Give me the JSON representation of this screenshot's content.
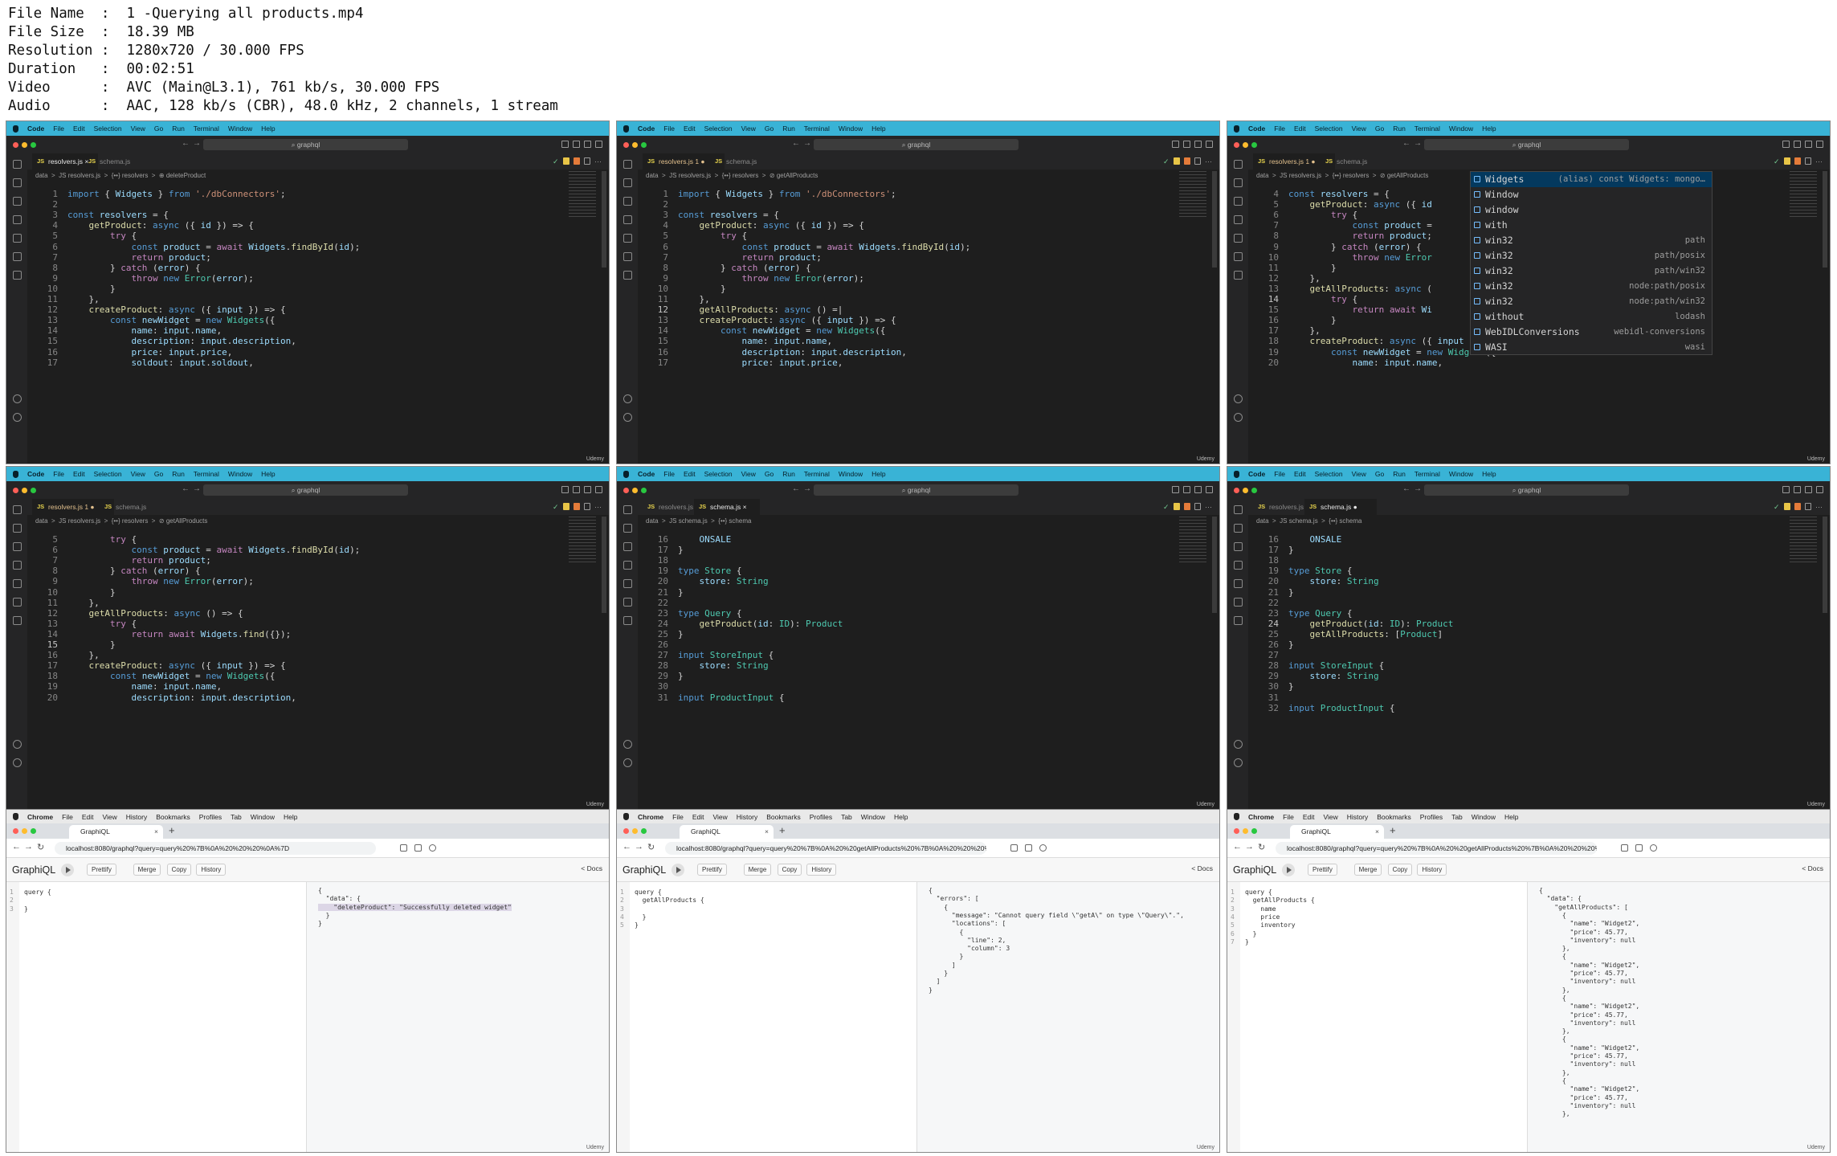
{
  "file_info": [
    "File Name  :  1 -Querying all products.mp4",
    "File Size  :  18.39 MB",
    "Resolution :  1280x720 / 30.000 FPS",
    "Duration   :  00:02:51",
    "Video      :  AVC (Main@L3.1), 761 kb/s, 30.000 FPS",
    "Audio      :  AAC, 128 kb/s (CBR), 48.0 kHz, 2 channels, 1 stream"
  ],
  "vscode_menu": [
    "Code",
    "File",
    "Edit",
    "Selection",
    "View",
    "Go",
    "Run",
    "Terminal",
    "Window",
    "Help"
  ],
  "chrome_menu": [
    "Chrome",
    "File",
    "Edit",
    "View",
    "History",
    "Bookmarks",
    "Profiles",
    "Tab",
    "Window",
    "Help"
  ],
  "command_center": "graphql",
  "watermark": "Udemy",
  "panels": [
    {
      "tabs": [
        {
          "name": "resolvers.js",
          "x": 6,
          "w": 62,
          "active": true,
          "close": "×"
        },
        {
          "name": "schema.js",
          "x": 70,
          "w": 60
        }
      ],
      "crumb": "data  >  JS resolvers.js  >  {••} resolvers  >  ⊕ deleteProduct",
      "start": 1,
      "cur": 0,
      "lines": [
        "<span class=k>import</span> { <span class=v>Widgets</span> } <span class=k>from</span> <span class=s>'./dbConnectors'</span>;",
        "",
        "<span class=k>const</span> <span class=v>resolvers</span> = {",
        "    <span class=f>getProduct</span>: <span class=k>async</span> ({ <span class=v>id</span> }) => {",
        "        <span class=c>try</span> {",
        "            <span class=k>const</span> <span class=v>product</span> = <span class=c>await</span> <span class=v>Widgets</span>.<span class=f>findById</span>(<span class=v>id</span>);",
        "            <span class=c>return</span> <span class=v>product</span>;",
        "        } <span class=c>catch</span> (<span class=v>error</span>) {",
        "            <span class=c>throw</span> <span class=k>new</span> <span class=t>Error</span>(<span class=v>error</span>);",
        "        }",
        "    },",
        "    <span class=f>createProduct</span>: <span class=k>async</span> ({ <span class=v>input</span> }) => {",
        "        <span class=k>const</span> <span class=v>newWidget</span> = <span class=k>new</span> <span class=t>Widgets</span>({",
        "            <span class=v>name</span>: <span class=v>input</span>.<span class=v>name</span>,",
        "            <span class=v>description</span>: <span class=v>input</span>.<span class=v>description</span>,",
        "            <span class=v>price</span>: <span class=v>input</span>.<span class=v>price</span>,",
        "            <span class=v>soldout</span>: <span class=v>input</span>.<span class=v>soldout</span>,"
      ]
    },
    {
      "tabs": [
        {
          "name": "resolvers.js 1 ●",
          "x": 6,
          "w": 82,
          "active": true,
          "mod": true
        },
        {
          "name": "schema.js",
          "x": 90,
          "w": 60
        }
      ],
      "crumb": "data  >  JS resolvers.js  >  {••} resolvers  >  ⊘ getAllProducts",
      "start": 1,
      "cur": 12,
      "lines": [
        "<span class=k>import</span> { <span class=v>Widgets</span> } <span class=k>from</span> <span class=s>'./dbConnectors'</span>;",
        "",
        "<span class=k>const</span> <span class=v>resolvers</span> = {",
        "    <span class=f>getProduct</span>: <span class=k>async</span> ({ <span class=v>id</span> }) => {",
        "        <span class=c>try</span> {",
        "            <span class=k>const</span> <span class=v>product</span> = <span class=c>await</span> <span class=v>Widgets</span>.<span class=f>findById</span>(<span class=v>id</span>);",
        "            <span class=c>return</span> <span class=v>product</span>;",
        "        } <span class=c>catch</span> (<span class=v>error</span>) {",
        "            <span class=c>throw</span> <span class=k>new</span> <span class=t>Error</span>(<span class=v>error</span>);",
        "        }",
        "    },",
        "    <span class=f>getAllProducts</span>: <span class=k>async</span> () =|",
        "    <span class=f>createProduct</span>: <span class=k>async</span> ({ <span class=v>input</span> }) => {",
        "        <span class=k>const</span> <span class=v>newWidget</span> = <span class=k>new</span> <span class=t>Widgets</span>({",
        "            <span class=v>name</span>: <span class=v>input</span>.<span class=v>name</span>,",
        "            <span class=v>description</span>: <span class=v>input</span>.<span class=v>description</span>,",
        "            <span class=v>price</span>: <span class=v>input</span>.<span class=v>price</span>,"
      ]
    },
    {
      "tabs": [
        {
          "name": "resolvers.js 1 ●",
          "x": 6,
          "w": 82,
          "active": true,
          "mod": true
        },
        {
          "name": "schema.js",
          "x": 90,
          "w": 60
        }
      ],
      "crumb": "data  >  JS resolvers.js  >  {••} resolvers  >  ⊘ getAllProducts",
      "start": 4,
      "cur": 14,
      "lines": [
        "<span class=k>const</span> <span class=v>resolvers</span> = {",
        "    <span class=f>getProduct</span>: <span class=k>async</span> ({ <span class=v>id</span>",
        "        <span class=c>try</span> {",
        "            <span class=k>const</span> <span class=v>product</span> =",
        "            <span class=c>return</span> <span class=v>product</span>;",
        "        } <span class=c>catch</span> (<span class=v>error</span>) {",
        "            <span class=c>throw</span> <span class=k>new</span> <span class=t>Error</span>",
        "        }",
        "    },",
        "    <span class=f>getAllProducts</span>: <span class=k>async</span> (",
        "        <span class=c>try</span> {",
        "            <span class=c>return</span> <span class=c>await</span> <span class=v>Wi</span>",
        "        }",
        "    },",
        "    <span class=f>createProduct</span>: <span class=k>async</span> ({ <span class=v>input</span> }) => {",
        "        <span class=k>const</span> <span class=v>newWidget</span> = <span class=k>new</span> <span class=t>Widgets</span>({",
        "            <span class=v>name</span>: <span class=v>input</span>.<span class=v>name</span>,"
      ]
    },
    {
      "tabs": [
        {
          "name": "resolvers.js 1 ●",
          "x": 6,
          "w": 82,
          "active": true,
          "mod": true
        },
        {
          "name": "schema.js",
          "x": 90,
          "w": 60
        }
      ],
      "crumb": "data  >  JS resolvers.js  >  {••} resolvers  >  ⊘ getAllProducts",
      "start": 5,
      "cur": 15,
      "lines": [
        "        <span class=c>try</span> {",
        "            <span class=k>const</span> <span class=v>product</span> = <span class=c>await</span> <span class=v>Widgets</span>.<span class=f>findById</span>(<span class=v>id</span>);",
        "            <span class=c>return</span> <span class=v>product</span>;",
        "        } <span class=c>catch</span> (<span class=v>error</span>) {",
        "            <span class=c>throw</span> <span class=k>new</span> <span class=t>Error</span>(<span class=v>error</span>);",
        "        }",
        "    },",
        "    <span class=f>getAllProducts</span>: <span class=k>async</span> () => {",
        "        <span class=c>try</span> {",
        "            <span class=c>return</span> <span class=c>await</span> <span class=v>Widgets</span>.<span class=f>find</span>({});",
        "        }",
        "    },",
        "    <span class=f>createProduct</span>: <span class=k>async</span> ({ <span class=v>input</span> }) => {",
        "        <span class=k>const</span> <span class=v>newWidget</span> = <span class=k>new</span> <span class=t>Widgets</span>({",
        "            <span class=v>name</span>: <span class=v>input</span>.<span class=v>name</span>,",
        "            <span class=v>description</span>: <span class=v>input</span>.<span class=v>description</span>,"
      ]
    },
    {
      "tabs": [
        {
          "name": "resolvers.js",
          "x": 6,
          "w": 62
        },
        {
          "name": "schema.js",
          "x": 70,
          "w": 62,
          "active": true,
          "close": "×"
        }
      ],
      "crumb": "data  >  JS schema.js  >  {••} schema",
      "start": 16,
      "cur": 0,
      "lines": [
        "    <span class=v>ONSALE</span>",
        "}",
        "",
        "<span class=k>type</span> <span class=t>Store</span> {",
        "    <span class=v>store</span>: <span class=t>String</span>",
        "}",
        "",
        "<span class=k>type</span> <span class=t>Query</span> {",
        "    <span class=f>getProduct</span>(<span class=v>id</span>: <span class=t>ID</span>): <span class=t>Product</span>",
        "}",
        "",
        "<span class=k>input</span> <span class=t>StoreInput</span> {",
        "    <span class=v>store</span>: <span class=t>String</span>",
        "}",
        "",
        "<span class=k>input</span> <span class=t>ProductInput</span> {"
      ]
    },
    {
      "tabs": [
        {
          "name": "resolvers.js",
          "x": 6,
          "w": 62
        },
        {
          "name": "schema.js ●",
          "x": 70,
          "w": 70,
          "active": true
        }
      ],
      "crumb": "data  >  JS schema.js  >  {••} schema",
      "start": 16,
      "cur": 24,
      "lines": [
        "    <span class=v>ONSALE</span>",
        "}",
        "",
        "<span class=k>type</span> <span class=t>Store</span> {",
        "    <span class=v>store</span>: <span class=t>String</span>",
        "}",
        "",
        "<span class=k>type</span> <span class=t>Query</span> {",
        "    <span class=f>getProduct</span>(<span class=v>id</span>: <span class=t>ID</span>): <span class=t>Product</span>",
        "    <span class=f>getAllProducts</span>: [<span class=t>Product</span>]",
        "}",
        "",
        "<span class=k>input</span> <span class=t>StoreInput</span> {",
        "    <span class=v>store</span>: <span class=t>String</span>",
        "}",
        "",
        "<span class=k>input</span> <span class=t>ProductInput</span> {"
      ]
    }
  ],
  "autocomplete": [
    {
      "label": "Widgets",
      "detail": "(alias) const Widgets: mongo…",
      "selected": true
    },
    {
      "label": "Window",
      "detail": ""
    },
    {
      "label": "window",
      "detail": ""
    },
    {
      "label": "with",
      "detail": ""
    },
    {
      "label": "win32",
      "detail": "path"
    },
    {
      "label": "win32",
      "detail": "path/posix"
    },
    {
      "label": "win32",
      "detail": "path/win32"
    },
    {
      "label": "win32",
      "detail": "node:path/posix"
    },
    {
      "label": "win32",
      "detail": "node:path/win32"
    },
    {
      "label": "without",
      "detail": "lodash"
    },
    {
      "label": "WebIDLConversions",
      "detail": "webidl-conversions"
    },
    {
      "label": "WASI",
      "detail": "wasi"
    }
  ],
  "graphiql": {
    "tab_title": "GraphiQL",
    "logo": "GraphiQL",
    "buttons": [
      "Prettify",
      "Merge",
      "Copy",
      "History"
    ],
    "docs": "< Docs",
    "panels": [
      {
        "url": "localhost:8080/graphql?query=query%20%7B%0A%20%20%20%0A%7D",
        "query": [
          "query {",
          "",
          "}"
        ],
        "result": [
          "{",
          "  \"data\": {",
          "    \"deleteProduct\": \"Successfully deleted widget\"",
          "  }",
          "}"
        ],
        "hl": 2
      },
      {
        "url": "localhost:8080/graphql?query=query%20%7B%0A%20%20getAllProducts%20%7B%0A%20%20%20%20%20%20%0A%20%20%7D%0A%7D",
        "query": [
          "query {",
          "  getAllProducts {",
          "",
          "  }",
          "}"
        ],
        "result": [
          "{",
          "  \"errors\": [",
          "    {",
          "      \"message\": \"Cannot query field \\\"getA\\\" on type \\\"Query\\\".\",",
          "      \"locations\": [",
          "        {",
          "          \"line\": 2,",
          "          \"column\": 3",
          "        }",
          "      ]",
          "    }",
          "  ]",
          "}"
        ]
      },
      {
        "url": "localhost:8080/graphql?query=query%20%7B%0A%20%20getAllProducts%20%7B%0A%20%20%20%20name%0A%20%20%20%20%20%20...",
        "query": [
          "query {",
          "  getAllProducts {",
          "    name",
          "    price",
          "    inventory",
          "  }",
          "}"
        ],
        "result": [
          "{",
          "  \"data\": {",
          "    \"getAllProducts\": [",
          "      {",
          "        \"name\": \"Widget2\",",
          "        \"price\": 45.77,",
          "        \"inventory\": null",
          "      },",
          "      {",
          "        \"name\": \"Widget2\",",
          "        \"price\": 45.77,",
          "        \"inventory\": null",
          "      },",
          "      {",
          "        \"name\": \"Widget2\",",
          "        \"price\": 45.77,",
          "        \"inventory\": null",
          "      },",
          "      {",
          "        \"name\": \"Widget2\",",
          "        \"price\": 45.77,",
          "        \"inventory\": null",
          "      },",
          "      {",
          "        \"name\": \"Widget2\",",
          "        \"price\": 45.77,",
          "        \"inventory\": null",
          "      },"
        ]
      }
    ]
  }
}
